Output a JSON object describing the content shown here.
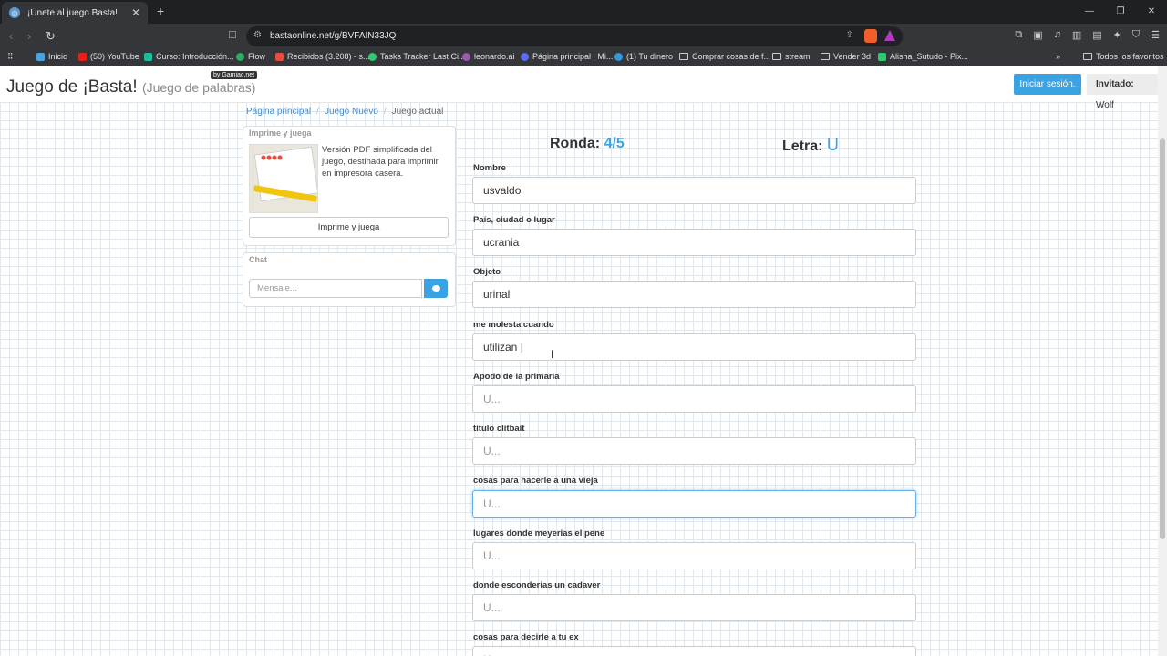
{
  "browser": {
    "tab_title": "¡Únete al juego Basta!",
    "url": "bastaonline.net/g/BVFAIN33JQ",
    "bookmarks": [
      {
        "label": "Inicio",
        "color": "#4aa3df"
      },
      {
        "label": "(50) YouTube",
        "color": "#e62117"
      },
      {
        "label": "Curso: Introducción...",
        "color": "#1abc9c"
      },
      {
        "label": "Flow",
        "color": "#27ae60"
      },
      {
        "label": "Recibidos (3.208) - s...",
        "color": "#e74c3c"
      },
      {
        "label": "Tasks Tracker Last Ci...",
        "color": "#2ecc71"
      },
      {
        "label": "leonardo.ai",
        "color": "#9b59b6"
      },
      {
        "label": "Página principal | Mi...",
        "color": "#5b6cf0"
      },
      {
        "label": "(1) Tu dinero",
        "color": "#3498db"
      },
      {
        "label": "Comprar cosas de f...",
        "color": "folder"
      },
      {
        "label": "stream",
        "color": "folder"
      },
      {
        "label": "Vender 3d",
        "color": "folder"
      },
      {
        "label": "Alisha_Sutudo - Pix...",
        "color": "#2ecc71"
      }
    ],
    "all_bookmarks": "Todos los favoritos"
  },
  "header": {
    "brand": "Juego de ¡Basta!",
    "brand_sub": "(Juego de palabras)",
    "badge": "by Gamiac.net",
    "login": "Iniciar sesión.",
    "guest_label": "Invitado:",
    "guest_name": "Wolf"
  },
  "breadcrumb": {
    "home": "Página principal",
    "new_game": "Juego Nuevo",
    "current": "Juego actual"
  },
  "print": {
    "title": "Imprime y juega",
    "description": "Versión PDF simplificada del juego, destinada para imprimir en impresora casera.",
    "button": "Imprime y juega"
  },
  "chat": {
    "title": "Chat",
    "placeholder": "Mensaje..."
  },
  "game": {
    "round_label": "Ronda:",
    "round_value": "4/5",
    "letter_label": "Letra:",
    "letter_value": "U",
    "fields": [
      {
        "label": "Nombre",
        "value": "usvaldo",
        "placeholder": "U..."
      },
      {
        "label": "País, ciudad o lugar",
        "value": "ucrania",
        "placeholder": "U..."
      },
      {
        "label": "Objeto",
        "value": "urinal",
        "placeholder": "U..."
      },
      {
        "label": "me molesta cuando",
        "value": "utilizan |",
        "placeholder": "U..."
      },
      {
        "label": "Apodo de la primaria",
        "value": "",
        "placeholder": "U..."
      },
      {
        "label": "titulo clitbait",
        "value": "",
        "placeholder": "U..."
      },
      {
        "label": "cosas para hacerle a una vieja",
        "value": "",
        "placeholder": "U..."
      },
      {
        "label": "lugares donde meyerias el pene",
        "value": "",
        "placeholder": "U..."
      },
      {
        "label": "donde esconderias un cadaver",
        "value": "",
        "placeholder": "U..."
      },
      {
        "label": "cosas para decirle a tu ex",
        "value": "",
        "placeholder": "U..."
      }
    ]
  }
}
